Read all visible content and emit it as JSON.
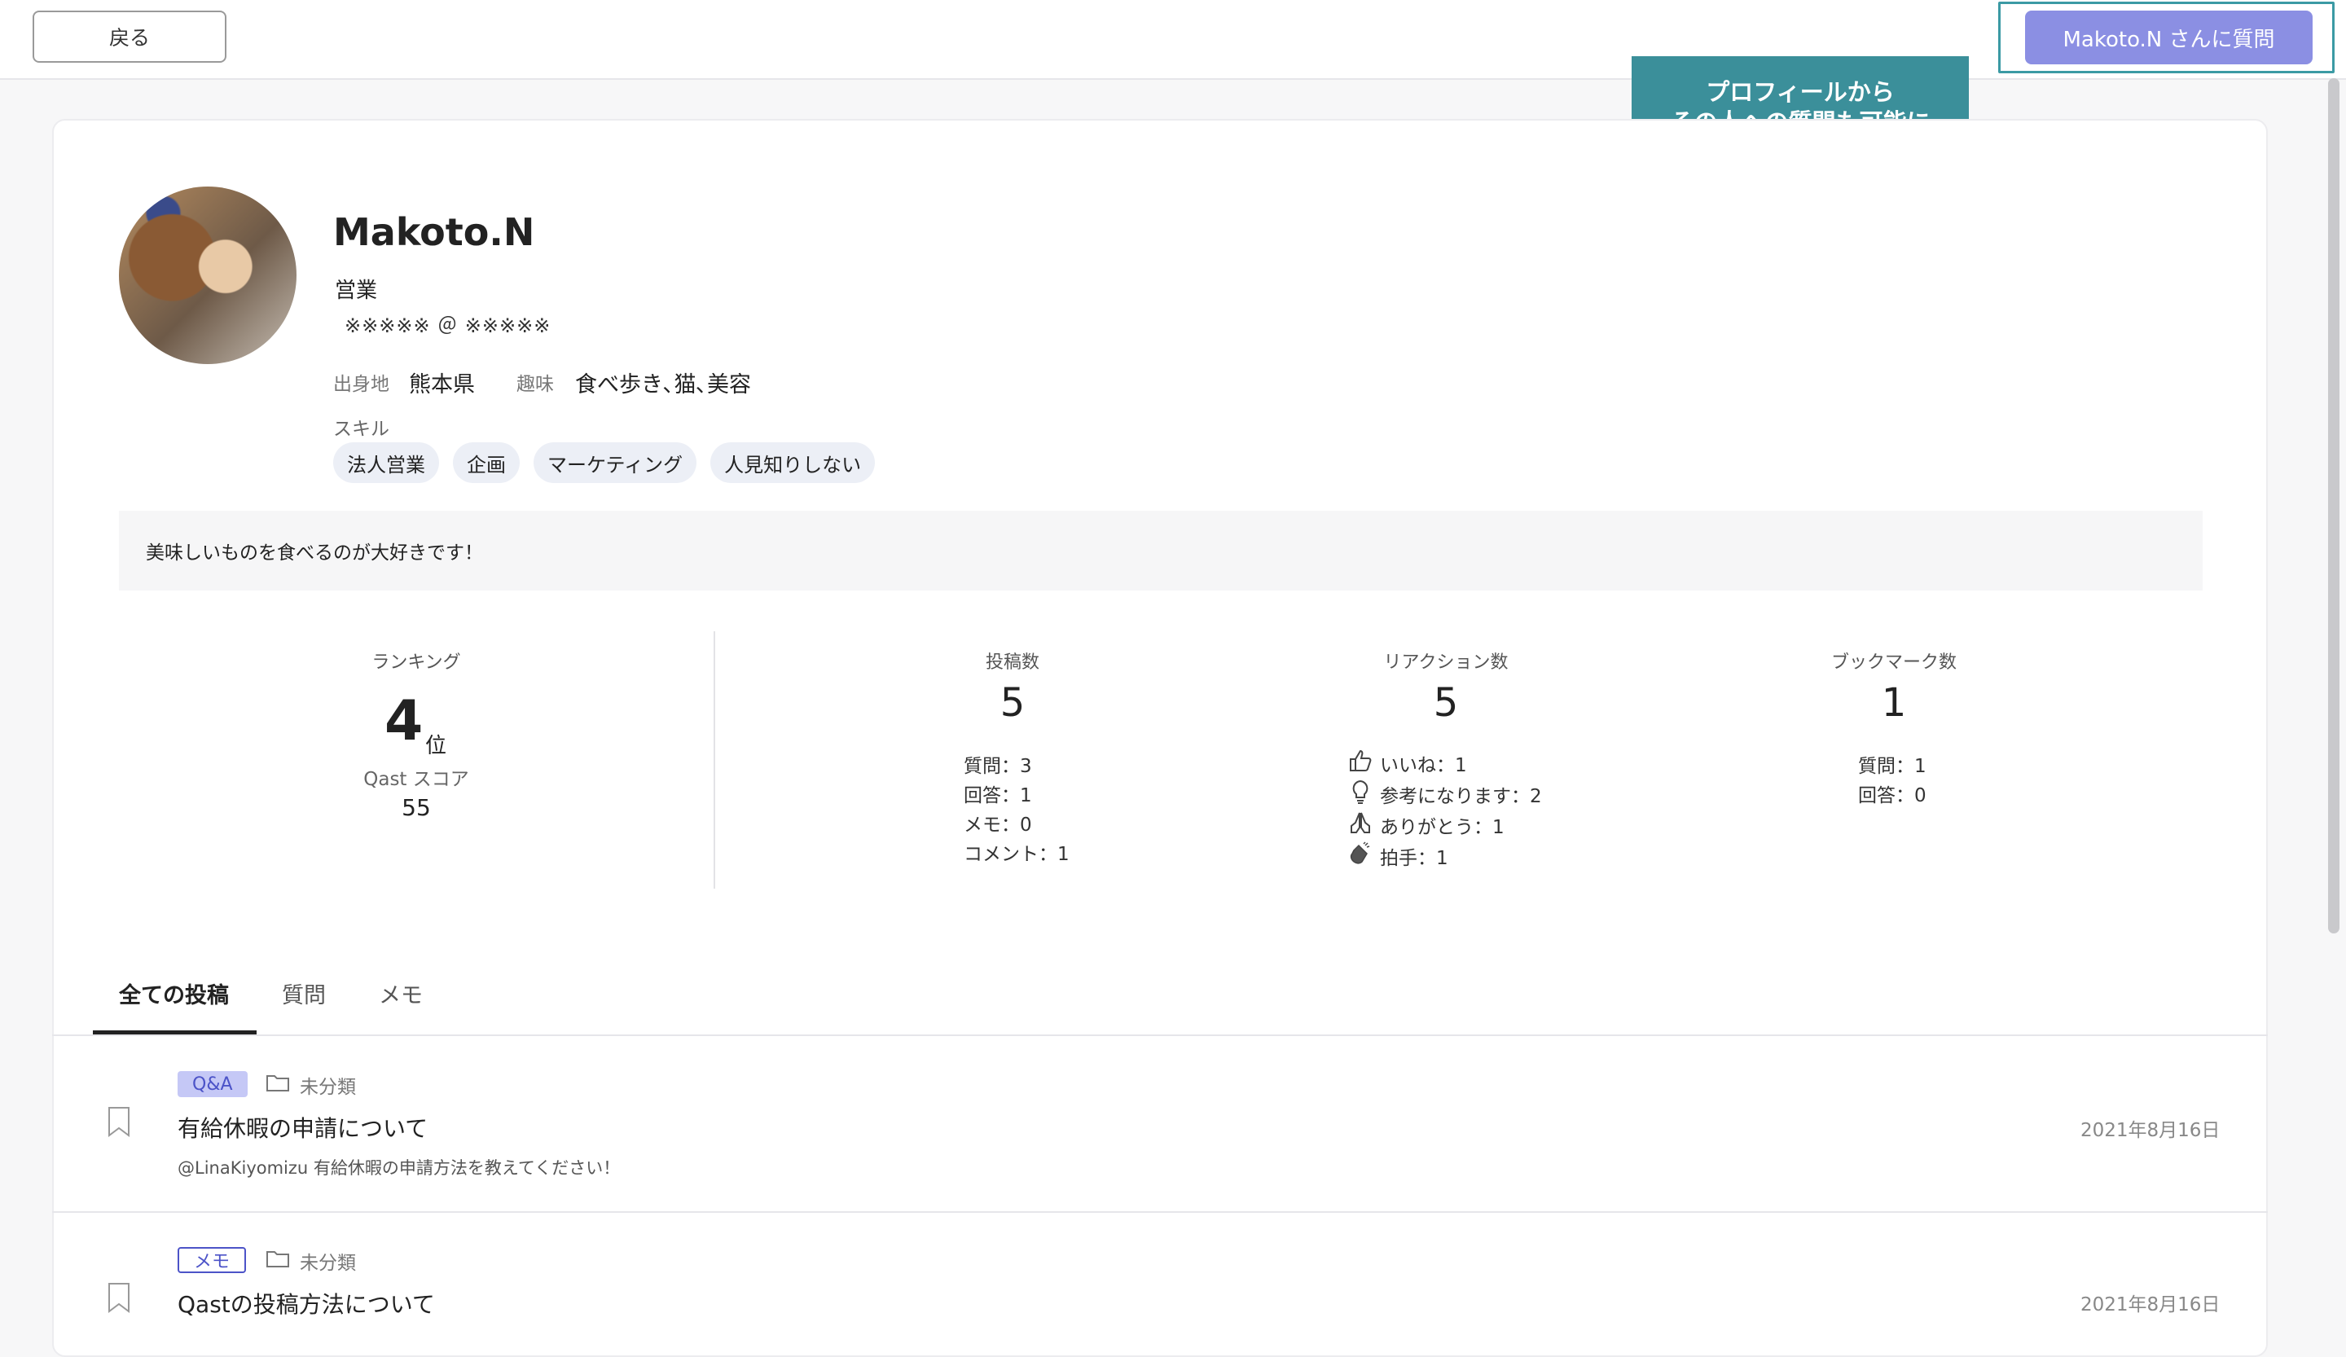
{
  "topbar": {
    "back_label": "戻る",
    "ask_button_label": "Makoto.N さんに質問"
  },
  "callout": {
    "line1": "プロフィールから",
    "line2": "その人への質問も可能に"
  },
  "profile": {
    "name": "Makoto.N",
    "department": "営業",
    "email": "※※※※※ ＠ ※※※※※",
    "hometown_label": "出身地",
    "hometown": "熊本県",
    "hobby_label": "趣味",
    "hobby": "食べ歩き､猫､美容",
    "skills_label": "スキル",
    "skills": [
      "法人営業",
      "企画",
      "マーケティング",
      "人見知りしない"
    ],
    "bio": "美味しいものを食べるのが大好きです！"
  },
  "stats": {
    "ranking": {
      "title": "ランキング",
      "rank": "4",
      "rank_suffix": "位",
      "score_label": "Qast スコア",
      "score": "55"
    },
    "posts": {
      "title": "投稿数",
      "total": "5",
      "breakdown": [
        "質問：3",
        "回答：1",
        "メモ：0",
        "コメント：1"
      ]
    },
    "reactions": {
      "title": "リアクション数",
      "total": "5",
      "items": [
        {
          "icon": "thumbs-up-icon",
          "label": "いいね：1"
        },
        {
          "icon": "lightbulb-icon",
          "label": "参考になります：2"
        },
        {
          "icon": "praying-hands-icon",
          "label": "ありがとう：1"
        },
        {
          "icon": "clapping-hands-icon",
          "label": "拍手：1"
        }
      ]
    },
    "bookmarks": {
      "title": "ブックマーク数",
      "total": "1",
      "breakdown": [
        "質問：1",
        "回答：0"
      ]
    }
  },
  "tabs": [
    "全ての投稿",
    "質問",
    "メモ"
  ],
  "active_tab": "全ての投稿",
  "posts": [
    {
      "type": "Q&A",
      "folder": "未分類",
      "title": "有給休暇の申請について",
      "snippet": "@LinaKiyomizu 有給休暇の申請方法を教えてください！",
      "date": "2021年8月16日"
    },
    {
      "type": "メモ",
      "folder": "未分類",
      "title": "Qastの投稿方法について",
      "date": "2021年8月16日"
    }
  ],
  "colors": {
    "accent": "#8b8fe3",
    "callout": "#3b8f9a",
    "badge_text": "#4c53c8"
  }
}
